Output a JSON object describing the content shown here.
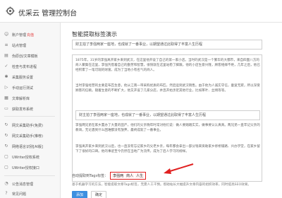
{
  "app": {
    "title": "优采云 管理控制台"
  },
  "sidebar": {
    "items": [
      {
        "label": "账户管理",
        "badge": "充值"
      },
      {
        "label": "站点管理"
      },
      {
        "label": "伪原创/文章模板"
      },
      {
        "label": "检查与发布进程"
      },
      {
        "label": "采集服务设置"
      },
      {
        "label": "手动运行测试"
      },
      {
        "label": "文章解析库"
      },
      {
        "label": "获取发布系统"
      },
      {
        "label": "网文采集助手(免费)"
      },
      {
        "label": "网文采集助手(推荐)"
      },
      {
        "label": "网络语言识别[AI版]"
      },
      {
        "label": "UWriter授权系统"
      },
      {
        "label": "UWriter授权接口"
      },
      {
        "label": "公告消息管理"
      },
      {
        "label": "常见问题"
      }
    ]
  },
  "main": {
    "page_title": "智能提取标签演示",
    "title_value": "财主拍了李强两家一座地，也成就了一番事业，以期望通过此取得了丰富人生历程",
    "paragraphs": [
      "1875年，31岁的李强离开家乡来到武汉，在这里他开设了自己的第一家小店。当时的武汉是一个繁华的大都市，来自四面八方的商人聚集在这里，李强凭借着自己的勤劳和智慧，很快就在这里站稳了脚跟。他的小店生意兴隆，顾客络绎不绝，几年之后，他已经积累了一笔可观的财富，成为了当地小有名气的商人。",
      "当时李强经营的主要是布匹生意，他从江南一带采购优质的布匹，然后运到武汉销售。由于他为人诚实守信，童叟无欺，所以深受顾客的信赖。随着生意的不断扩大，他又开设了几家分店，并且开始涉足其他行业，比如茶叶、丝绸等等。",
      "李强两兄弟在家乡置办了大量的田产，他们的父亲晚年时常对他们说：做人要踏踏实实，做事要认认真真。两兄弟一直牢记父亲的教诲，无论遇到什么困难都没有放弃，最终成就了一番事业。",
      "李强离开家乡来到武汉以后，也一直没有忘记家乡的父老乡亲，每年都会拿出一部分钱来资助家乡修桥铺路、兴办学堂，在家乡留下了很好的口碑。他的事迹至今仍然在当地广为流传，成为了后人学习的榜样。"
    ],
    "quote": "财主拍了李强两家一座地，也成就了一番事业，以期望通过此取得了丰富人生历程",
    "tags_label": "自动提取到Tags标签：",
    "tags": [
      "李强两",
      "商人",
      "人生"
    ],
    "hint": "基于机器学习的方法，智能提取文章Tags标签，无需人工干预。帮助站长大幅提升文章内容的组织效率，同时提高SEO效果。",
    "buttons": {
      "primary": "添加",
      "secondary": "确定"
    }
  },
  "colors": {
    "accent": "#3d8fe0",
    "highlight": "#e02020"
  }
}
